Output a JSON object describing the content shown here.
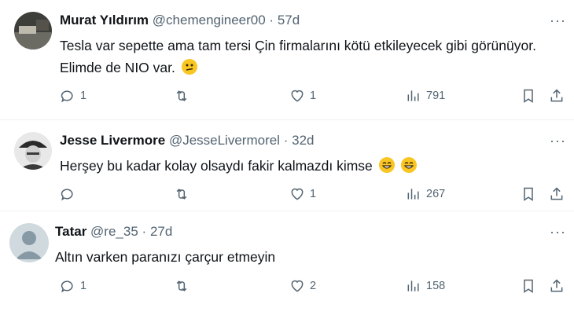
{
  "tweets": [
    {
      "name": "Murat Yıldırım",
      "handle": "@chemengineer00",
      "separator": "·",
      "time": "57d",
      "text": "Tesla var sepette ama tam tersi Çin firmalarını kötü etkileyecek gibi görünüyor. Elimde de NIO var.",
      "emoji": "confused-face",
      "replies": "1",
      "retweets": "",
      "likes": "1",
      "views": "791"
    },
    {
      "name": "Jesse Livermore",
      "handle": "@JesseLivermorel",
      "separator": "·",
      "time": "32d",
      "text": "Herşey bu kadar kolay olsaydı fakir kalmazdı kimse",
      "emoji": "grinning-face",
      "replies": "",
      "retweets": "",
      "likes": "1",
      "views": "267"
    },
    {
      "name": "Tatar",
      "handle": "@re_35",
      "separator": "·",
      "time": "27d",
      "text": "Altın varken paranızı çarçur etmeyin",
      "emoji": "",
      "replies": "1",
      "retweets": "",
      "likes": "2",
      "views": "158"
    }
  ],
  "colors": {
    "text": "#0f1419",
    "muted": "#536471",
    "divider": "#eff3f4",
    "emoji": "#f9c623"
  },
  "icons": [
    "reply-icon",
    "retweet-icon",
    "like-icon",
    "views-icon",
    "bookmark-icon",
    "share-icon",
    "more-icon"
  ]
}
